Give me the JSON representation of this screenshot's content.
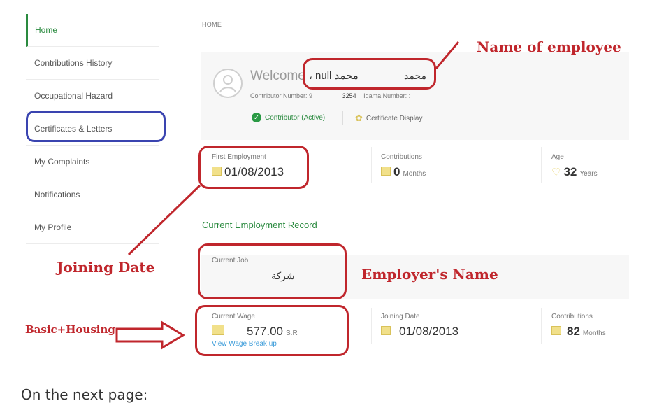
{
  "sidebar": {
    "items": [
      {
        "label": "Home"
      },
      {
        "label": "Contributions History"
      },
      {
        "label": "Occupational Hazard"
      },
      {
        "label": "Certificates & Letters"
      },
      {
        "label": "My Complaints"
      },
      {
        "label": "Notifications"
      },
      {
        "label": "My Profile"
      }
    ]
  },
  "breadcrumb": "HOME",
  "welcome": {
    "greeting": "Welcome",
    "name_part1": "محمد null ،",
    "name_part2": "محمد",
    "contributor_label": "Contributor Number: 9",
    "contributor_value": "3254",
    "iqama_label": "Iqama Number: :",
    "status": "Contributor (Active)",
    "certificate": "Certificate Display"
  },
  "stats": {
    "first_employment": {
      "label": "First Employment",
      "value": "01/08/2013"
    },
    "contributions": {
      "label": "Contributions",
      "value": "0",
      "unit": "Months"
    },
    "age": {
      "label": "Age",
      "value": "32",
      "unit": "Years"
    }
  },
  "current_record": {
    "title": "Current Employment Record",
    "job_label": "Current Job",
    "job_value": "شركة",
    "wage_label": "Current Wage",
    "wage_value": "577.00",
    "wage_unit": "S.R",
    "wage_link": "View Wage Break up",
    "joining_label": "Joining Date",
    "joining_value": "01/08/2013",
    "contrib_label": "Contributions",
    "contrib_value": "82",
    "contrib_unit": "Months"
  },
  "annotations": {
    "name_of_employee": "Name of employee",
    "joining_date": "Joining Date",
    "employers_name": "Employer's Name",
    "basic_housing": "Basic+Housing"
  },
  "footer_text": "On the next page:",
  "colors": {
    "accent_green": "#2a8a3f",
    "annotation_red": "#c0262c",
    "annotation_blue": "#3a44b0"
  }
}
